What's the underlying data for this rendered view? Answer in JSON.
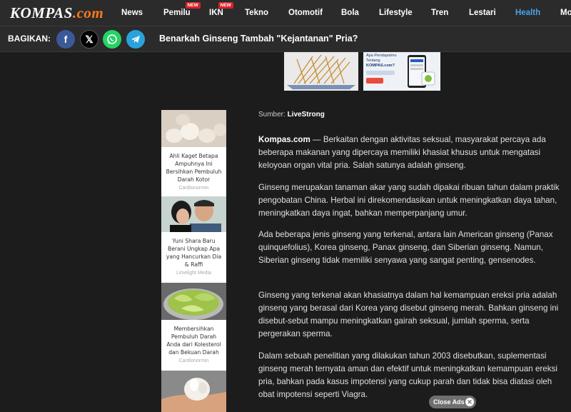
{
  "header": {
    "logo_main": "KOMPAS",
    "logo_suffix": ".com",
    "nav": [
      {
        "label": "News"
      },
      {
        "label": "Pemilu",
        "badge": "NEW"
      },
      {
        "label": "IKN",
        "badge": "NEW"
      },
      {
        "label": "Tekno"
      },
      {
        "label": "Otomotif"
      },
      {
        "label": "Bola"
      },
      {
        "label": "Lifestyle"
      },
      {
        "label": "Tren"
      },
      {
        "label": "Lestari"
      },
      {
        "label": "Health",
        "active": true
      },
      {
        "label": "Mo"
      }
    ]
  },
  "share": {
    "label": "BAGIKAN:",
    "buttons": [
      "facebook",
      "x",
      "whatsapp",
      "telegram"
    ],
    "title": "Benarkah Ginseng Tambah \"Kejantanan\" Pria?"
  },
  "top_ads": {
    "app_line1": "Apa Pendapatmu",
    "app_line2": "Tentang",
    "app_line3": "KOMPAS.com?"
  },
  "sidebar": {
    "close": "✕",
    "items": [
      {
        "text": "Ahli Kaget Betapa Ampuhnya Ini Bersihkan Pembuluh Darah Kotor",
        "source": "Cardionormin"
      },
      {
        "text": "Yuni Shara Baru Berani Ungkap Apa yang Hancurkan Dia & Raffi",
        "source": "Limelight Media"
      },
      {
        "text": "Membersihkan Pembuluh Darah Anda dari Kolesterol dan Bekuan Darah",
        "source": "Cardionormin"
      }
    ]
  },
  "article": {
    "source_label": "Sumber:",
    "source_name": "LiveStrong",
    "lead": "Kompas.com",
    "p1": " — Berkaitan dengan aktivitas seksual, masyarakat percaya ada beberapa makanan yang dipercaya memiliki khasiat khusus untuk mengatasi keloyoan organ vital pria. Salah satunya adalah ginseng.",
    "p2": "Ginseng merupakan tanaman akar yang sudah dipakai ribuan tahun dalam praktik pengobatan China. Herbal ini direkomendasikan untuk meningkatkan daya tahan, meningkatkan daya ingat, bahkan memperpanjang umur.",
    "p3": "Ada beberapa jenis ginseng yang terkenal, antara lain American ginseng (Panax quinquefolius), Korea ginseng, Panax ginseng, dan Siberian ginseng. Namun, Siberian ginseng tidak memiliki senyawa yang sangat penting, gensenodes.",
    "p4": "Ginseng yang terkenal akan khasiatnya dalam hal kemampuan ereksi pria adalah ginseng yang berasal dari Korea yang disebut ginseng merah. Bahkan ginseng ini disebut-sebut mampu meningkatkan gairah seksual, jumlah sperma, serta pergerakan sperma.",
    "p5": "Dalam sebuah penelitian yang dilakukan tahun 2003 disebutkan, suplementasi ginseng merah ternyata aman dan efektif untuk meningkatkan kemampuan ereksi pria, bahkan pada kasus impotensi yang cukup parah dan tidak bisa diatasi oleh obat impotensi seperti Viagra."
  },
  "close_ads": "Close Ads"
}
